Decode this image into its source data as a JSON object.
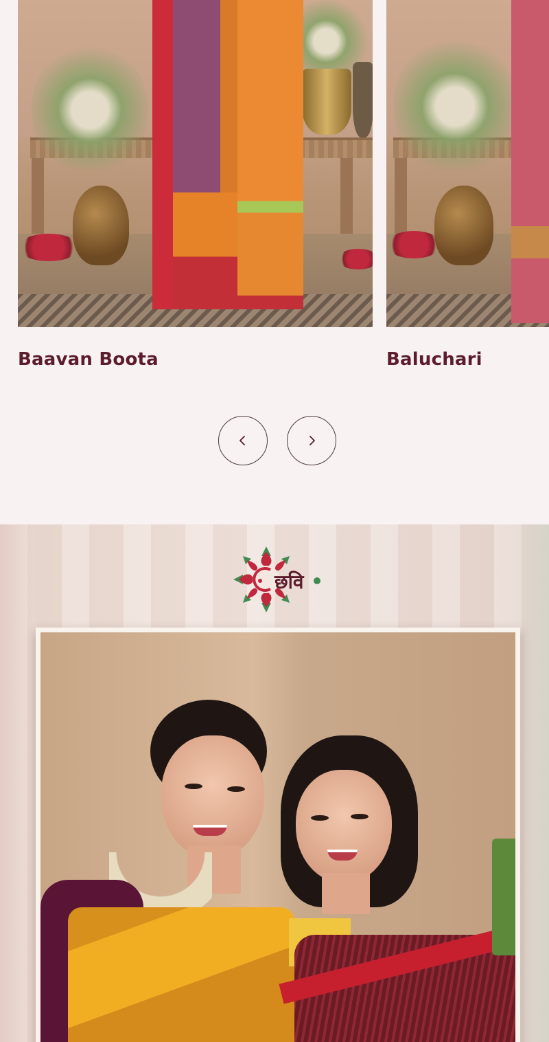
{
  "carousel": {
    "products": [
      {
        "title": "Baavan Boota"
      },
      {
        "title": "Baluchari"
      }
    ],
    "prev_icon": "chevron-left-icon",
    "next_icon": "chevron-right-icon"
  },
  "banner": {
    "logo_text": "छवि",
    "logo_icon": "mandala-flower-icon"
  },
  "colors": {
    "page_bg": "#f8f2f2",
    "title_color": "#5b1c2c",
    "logo_red": "#c0283e",
    "logo_green": "#3f8b52"
  }
}
